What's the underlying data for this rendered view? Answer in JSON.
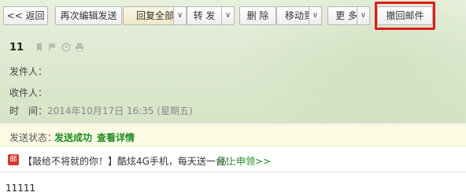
{
  "toolbar": {
    "back_label": "<< 返回",
    "resend_label": "再次编辑发送",
    "reply_all_label": "回复全部",
    "forward_label": "转 发",
    "delete_label": "删 除",
    "move_label": "移动到",
    "more_label": "更 多",
    "recall_label": "撤回邮件",
    "dropdown_glyph": "∨"
  },
  "mail": {
    "subject": "11",
    "from_label": "发件人：",
    "to_label": "收件人：",
    "time_label": "时　间：",
    "time_value": "2014年10月17日 16:35 (星期五)"
  },
  "status": {
    "label": "发送状态：",
    "value": "发送成功",
    "detail_link": "查看详情"
  },
  "ad": {
    "icon_glyph": "邮",
    "text": "【敲给不将就的你！】酷炫4G手机，每天送一台！",
    "link": "马上申领>>"
  },
  "body": {
    "content": "11111"
  },
  "colors": {
    "accent_green": "#1f8b1f",
    "highlight_red": "#e0181b"
  }
}
